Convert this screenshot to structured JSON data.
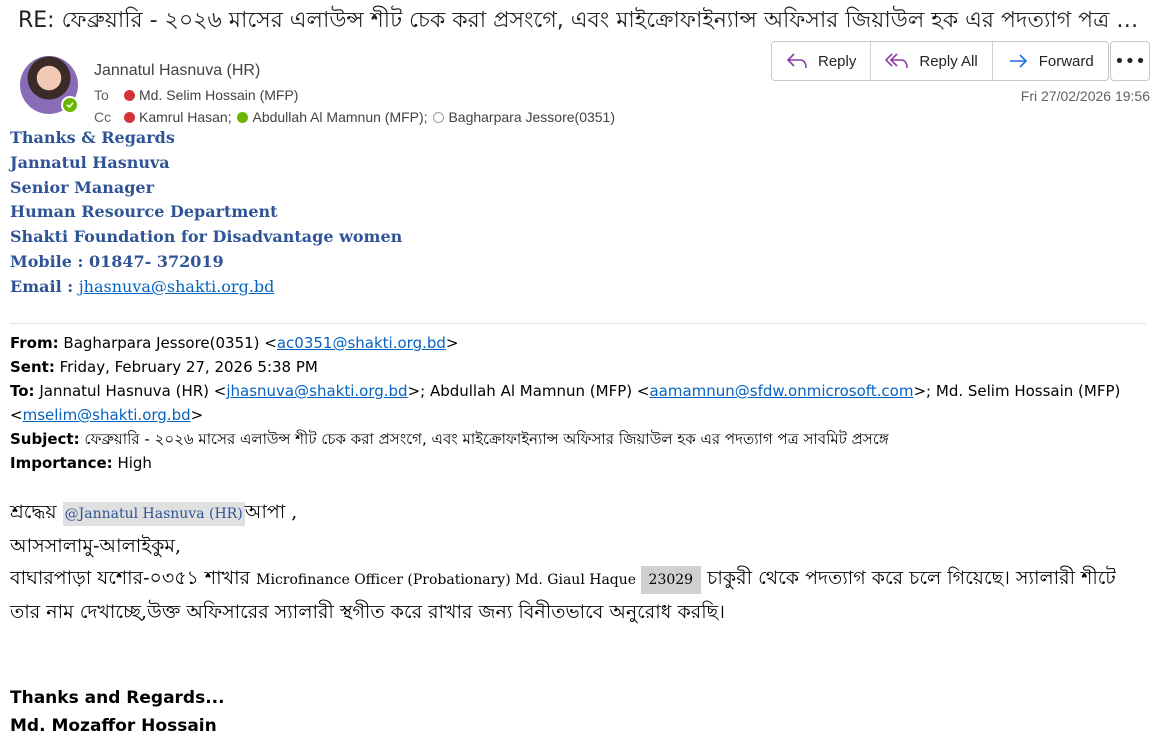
{
  "email": {
    "subject": "RE:  ফেব্রুয়ারি - ২০২৬ মাসের এলাউন্স শীট চেক করা প্রসংগে, এবং  মাইক্রোফাইন্যান্স অফিসার জিয়াউল হক এর পদত্যাগ পত্র সাবমিট প্রসঙ্গে",
    "sender": "Jannatul Hasnuva (HR)",
    "to_label": "To",
    "to": [
      {
        "name": "Md. Selim Hossain (MFP)",
        "status": "red"
      }
    ],
    "cc_label": "Cc",
    "cc": [
      {
        "name": "Kamrul Hasan;",
        "status": "red"
      },
      {
        "name": "Abdullah Al Mamnun (MFP);",
        "status": "green"
      },
      {
        "name": "Bagharpara Jessore(0351)",
        "status": "empty"
      }
    ],
    "date": "Fri 27/02/2026 19:56"
  },
  "actions": {
    "reply": "Reply",
    "reply_all": "Reply All",
    "forward": "Forward",
    "more": "•••"
  },
  "signature": {
    "line1": "Thanks & Regards",
    "line2": "Jannatul Hasnuva",
    "line3": "Senior Manager",
    "line4": "Human Resource Department",
    "line5": "Shakti Foundation for Disadvantage women",
    "mobile_label": "Mobile : ",
    "mobile": "01847- 372019",
    "email_label": "Email : ",
    "email": "jhasnuva@shakti.org.bd"
  },
  "quoted": {
    "from_label": "From:",
    "from_name": "Bagharpara Jessore(0351) <",
    "from_email": "ac0351@shakti.org.bd",
    "from_close": ">",
    "sent_label": "Sent:",
    "sent": "Friday, February 27, 2026 5:38 PM",
    "to_label": "To:",
    "to_1": "Jannatul Hasnuva (HR) <",
    "to_1_email": "jhasnuva@shakti.org.bd",
    "to_2": ">; Abdullah Al Mamnun (MFP) <",
    "to_2_email": "aamamnun@sfdw.onmicrosoft.com",
    "to_3": ">; Md. Selim Hossain (MFP)",
    "to_3_open": "<",
    "to_3_email": "mselim@shakti.org.bd",
    "to_3_close": ">",
    "subject_label": "Subject:",
    "subject": "ফেব্রুয়ারি - ২০২৬ মাসের এলাউন্স শীট চেক করা প্রসংগে, এবং মাইক্রোফাইন্যান্স অফিসার জিয়াউল হক এর পদত্যাগ পত্র সাবমিট প্রসঙ্গে",
    "importance_label": "Importance:",
    "importance": "High"
  },
  "body": {
    "greet_pre": "শ্রদ্ধেয় ",
    "mention": "@Jannatul Hasnuva (HR)",
    "greet_post": "আপা ,",
    "salam": "আসসালামু-আলাইকুম,",
    "p1_a": "বাঘারপাড়া যশোর-০৩৫১ শাখার  ",
    "p1_role": "Microfinance Officer (Probationary)  Md. Giaul Haque  ",
    "p1_id": "23029",
    "p1_b": " চাকুরী থেকে পদত্যাগ করে চলে গিয়েছে। স্যালারী শীটে তার নাম দেখাচ্ছে,উক্ত অফিসারের স্যালারী স্থগীত করে রাখার জন্য বিনীতভাবে অনুরোধ করছি।"
  },
  "footer": {
    "thanks": "Thanks and Regards...",
    "name": "Md. Mozaffor Hossain"
  }
}
